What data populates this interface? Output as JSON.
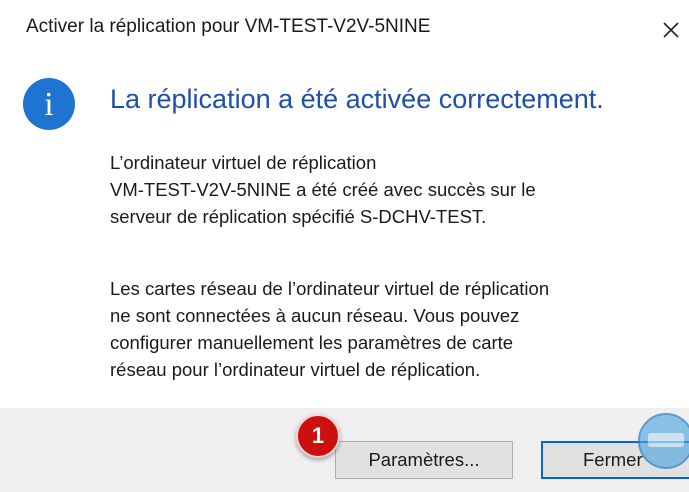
{
  "window": {
    "title": "Activer la réplication pour VM-TEST-V2V-5NINE",
    "close_symbol": "✕"
  },
  "icons": {
    "info": "info-icon",
    "close": "close-icon",
    "info_glyph": "i"
  },
  "message": {
    "heading": "La réplication a été activée correctement.",
    "paragraph1": [
      "L’ordinateur virtuel de réplication",
      "VM-TEST-V2V-5NINE a été créé avec succès sur le",
      "serveur de réplication spécifié S-DCHV-TEST."
    ],
    "paragraph2": [
      "Les cartes réseau de l’ordinateur virtuel de réplication",
      "ne sont connectées à aucun réseau. Vous pouvez",
      "configurer manuellement les paramètres de carte",
      "réseau pour l’ordinateur virtuel de réplication."
    ]
  },
  "buttons": {
    "settings_label": "Paramètres...",
    "close_label": "Fermer"
  },
  "annotation": {
    "step_number": "1"
  },
  "colors": {
    "accent": "#1e74d0",
    "heading": "#1f4fa8",
    "default_button_border": "#0a64d6",
    "badge": "#cc1010",
    "footer": "#efefef"
  }
}
